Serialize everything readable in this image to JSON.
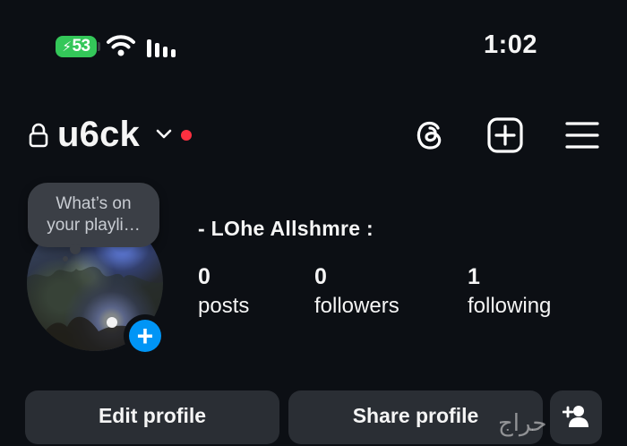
{
  "status_bar": {
    "battery": "53",
    "time": "1:02"
  },
  "header": {
    "username": "u6ck"
  },
  "profile": {
    "note": "What’s on your playli…",
    "display_name": "- LOhe Allshmre :",
    "stats": [
      {
        "value": "0",
        "label": "posts"
      },
      {
        "value": "0",
        "label": "followers"
      },
      {
        "value": "1",
        "label": "following"
      }
    ]
  },
  "buttons": {
    "edit": "Edit profile",
    "share": "Share profile"
  },
  "watermark": "حراج",
  "colors": {
    "background": "#0c0f14",
    "battery": "#34c759",
    "notification_dot": "#ff3040",
    "add_story": "#0095f6",
    "button_bg": "#2a2e34"
  },
  "icons": [
    "bolt-icon",
    "wifi-icon",
    "cellular-signal-icon",
    "lock-icon",
    "chevron-down-icon",
    "threads-icon",
    "new-post-icon",
    "menu-icon",
    "plus-icon",
    "add-person-icon"
  ]
}
